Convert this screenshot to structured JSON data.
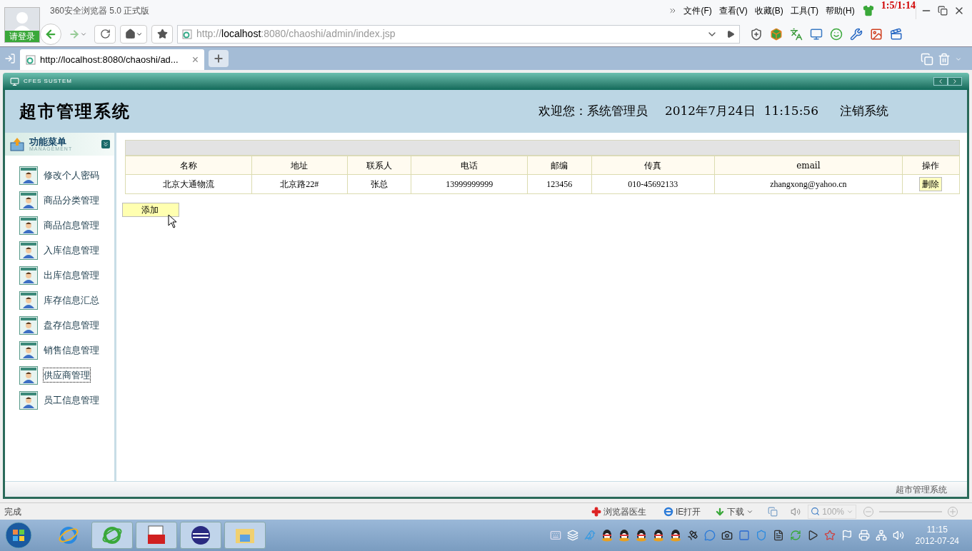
{
  "browser": {
    "title": "360安全浏览器 5.0 正式版",
    "login": "请登录",
    "menu": [
      "文件(F)",
      "查看(V)",
      "收藏(B)",
      "工具(T)",
      "帮助(H)"
    ],
    "overlay_time": "1:5/1:14",
    "url": {
      "scheme": "http://",
      "host": "localhost",
      "rest": ":8080/chaoshi/admin/index.jsp"
    },
    "tab": {
      "title": "http://localhost:8080/chaoshi/ad...",
      "close": "×"
    }
  },
  "app": {
    "banner": "CFES SUSTEM",
    "title": "超市管理系统",
    "welcome": "欢迎您：系统管理员",
    "date": "2012年7月24日",
    "time": "11:15:56",
    "logout": "注销系统",
    "menu_title": "功能菜单",
    "menu_subtitle": "MANAGEMENT",
    "menu": [
      {
        "label": "修改个人密码",
        "selected": false
      },
      {
        "label": "商品分类管理",
        "selected": false
      },
      {
        "label": "商品信息管理",
        "selected": false
      },
      {
        "label": "入库信息管理",
        "selected": false
      },
      {
        "label": "出库信息管理",
        "selected": false
      },
      {
        "label": "库存信息汇总",
        "selected": false
      },
      {
        "label": "盘存信息管理",
        "selected": false
      },
      {
        "label": "销售信息管理",
        "selected": false
      },
      {
        "label": "供应商管理",
        "selected": true
      },
      {
        "label": "员工信息管理",
        "selected": false
      }
    ],
    "table": {
      "columns": [
        "名称",
        "地址",
        "联系人",
        "电话",
        "邮编",
        "传真",
        "email",
        "操作"
      ],
      "rows": [
        {
          "cells": [
            "北京大通物流",
            "北京路22#",
            "张总",
            "13999999999",
            "123456",
            "010-45692133",
            "zhangxong@yahoo.cn"
          ],
          "action": "删除"
        }
      ]
    },
    "add": "添加",
    "footer": "超市管理系统"
  },
  "status_bar": {
    "text": "完成",
    "doctor": "浏览器医生",
    "ie": "IE打开",
    "download": "下载",
    "zoom": "100%"
  },
  "taskbar": {
    "time": "11:15",
    "date": "2012-07-24"
  }
}
